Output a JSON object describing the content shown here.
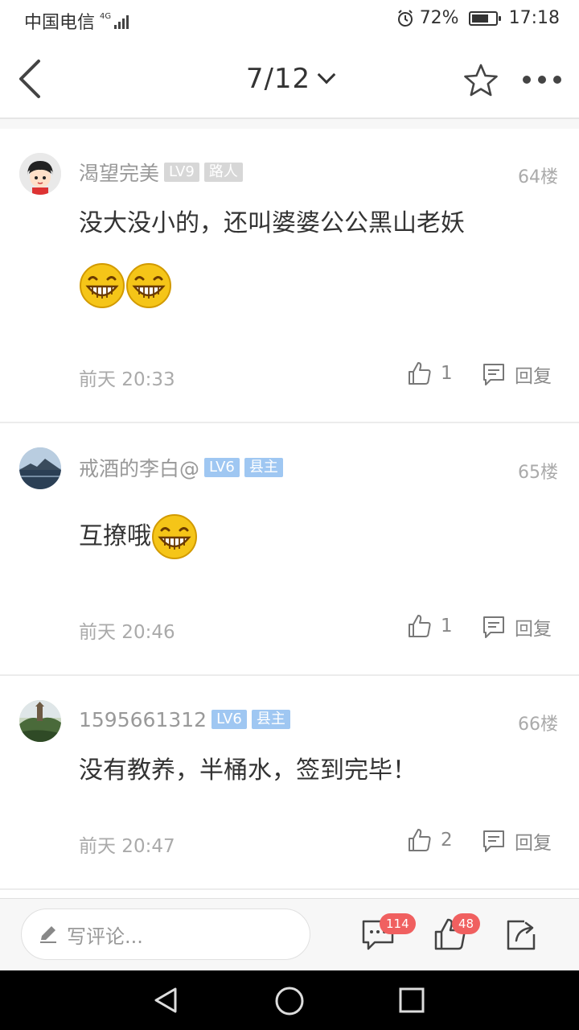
{
  "status_bar": {
    "carrier": "中国电信",
    "network": "4G",
    "battery_percent": "72%",
    "battery_level": 0.72,
    "time": "17:18"
  },
  "nav": {
    "page_indicator": "7/12"
  },
  "comments": [
    {
      "username": "渴望完美",
      "level": "LV9",
      "title": "路人",
      "level_style": "gray",
      "floor": "64楼",
      "text": "没大没小的，还叫婆婆公公黑山老妖",
      "emoji_count": 2,
      "time": "前天 20:33",
      "likes": "1",
      "reply_label": "回复"
    },
    {
      "username": "戒酒的李白@",
      "level": "LV6",
      "title": "县主",
      "level_style": "blue",
      "floor": "65楼",
      "text": "互撩哦",
      "emoji_count": 1,
      "time": "前天 20:46",
      "likes": "1",
      "reply_label": "回复"
    },
    {
      "username": "1595661312",
      "level": "LV6",
      "title": "县主",
      "level_style": "blue",
      "floor": "66楼",
      "text": "没有教养，半桶水，签到完毕！",
      "emoji_count": 0,
      "time": "前天 20:47",
      "likes": "2",
      "reply_label": "回复"
    }
  ],
  "bottom_bar": {
    "comment_placeholder": "写评论...",
    "comment_count": "114",
    "like_count": "48"
  },
  "colors": {
    "badge": "#f06060",
    "tag_gray": "#d7d7d7",
    "tag_blue": "#9fc7f2",
    "emoji_yellow": "#f5c518"
  }
}
